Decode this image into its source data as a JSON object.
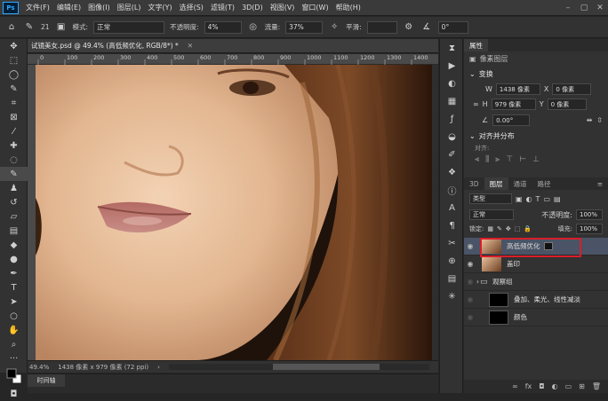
{
  "menubar": {
    "logo": "Ps",
    "items": [
      "文件(F)",
      "编辑(E)",
      "图像(I)",
      "图层(L)",
      "文字(Y)",
      "选择(S)",
      "滤镜(T)",
      "3D(D)",
      "视图(V)",
      "窗口(W)",
      "帮助(H)"
    ],
    "window_controls": [
      "–",
      "▢",
      "✕"
    ]
  },
  "options": {
    "brush_size": "21",
    "mode_label": "模式:",
    "mode_value": "正常",
    "opacity_label": "不透明度:",
    "opacity_value": "4%",
    "flow_label": "流量:",
    "flow_value": "37%",
    "smooth_label": "平滑:",
    "angle_value": "0°"
  },
  "document": {
    "tab_title": "试镜美女.psd @ 49.4% (高低频优化, RGB/8*) *",
    "ruler_ticks": [
      "0",
      "100",
      "200",
      "300",
      "400",
      "500",
      "600",
      "700",
      "800",
      "900",
      "1000",
      "1100",
      "1200",
      "1300",
      "1400"
    ],
    "zoom": "49.4%",
    "doc_info": "1438 像素 x 979 像素 (72 ppi)"
  },
  "timeline": {
    "label": "时间轴"
  },
  "properties": {
    "tab": "属性",
    "pixel_layer": "像素图层",
    "transform_title": "变换",
    "w_label": "W",
    "w_value": "1438 像素",
    "h_label": "H",
    "h_value": "979 像素",
    "x_label": "X",
    "x_value": "0 像素",
    "y_label": "Y",
    "y_value": "0 像素",
    "angle": "0.00°",
    "align_title": "对齐并分布",
    "align_label": "对齐:"
  },
  "layers_panel": {
    "tabs": [
      "3D",
      "图层",
      "通道",
      "路径"
    ],
    "filter_label": "类型",
    "blend_mode": "正常",
    "opacity_label": "不透明度:",
    "opacity": "100%",
    "lock_label": "锁定:",
    "fill_label": "填充:",
    "fill": "100%",
    "layers": [
      {
        "name": "高低频优化",
        "selected": true,
        "thumb": "photo"
      },
      {
        "name": "盖印",
        "selected": false,
        "thumb": "photo"
      },
      {
        "name": "观察组",
        "selected": false,
        "thumb": "folder"
      },
      {
        "name": "叠加、柔光、线性减淡",
        "selected": false,
        "thumb": "black"
      },
      {
        "name": "颜色",
        "selected": false,
        "thumb": "black"
      }
    ]
  },
  "colors": {
    "highlight": "#d81e2a",
    "accent": "#31a8ff"
  }
}
